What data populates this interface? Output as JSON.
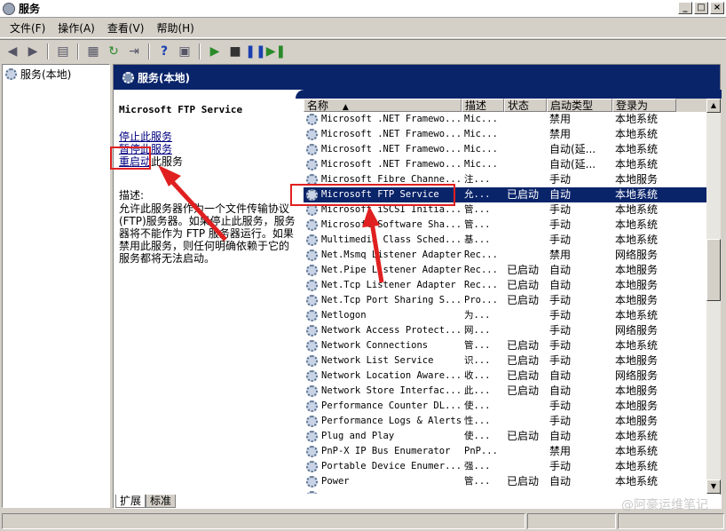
{
  "window": {
    "title": "服务"
  },
  "menu": [
    "文件(F)",
    "操作(A)",
    "查看(V)",
    "帮助(H)"
  ],
  "tree": {
    "root": "服务(本地)"
  },
  "panel": {
    "header": "服务(本地)",
    "selected_service": "Microsoft FTP Service",
    "actions": {
      "stop": "停止此服务",
      "pause": "暂停此服务",
      "restart_link": "重启动",
      "restart_suffix": "此服务"
    },
    "desc_label": "描述:",
    "desc_text": "允许此服务器作为一个文件传输协议(FTP)服务器。如果停止此服务，服务器将不能作为 FTP 服务器运行。如果禁用此服务，则任何明确依赖于它的服务都将无法启动。"
  },
  "columns": {
    "name": "名称",
    "desc": "描述",
    "status": "状态",
    "startup": "启动类型",
    "logon": "登录为"
  },
  "services": [
    {
      "name": "Microsoft .NET Framewo...",
      "desc": "Mic...",
      "status": "",
      "startup": "禁用",
      "logon": "本地系统"
    },
    {
      "name": "Microsoft .NET Framewo...",
      "desc": "Mic...",
      "status": "",
      "startup": "禁用",
      "logon": "本地系统"
    },
    {
      "name": "Microsoft .NET Framewo...",
      "desc": "Mic...",
      "status": "",
      "startup": "自动(延...",
      "logon": "本地系统"
    },
    {
      "name": "Microsoft .NET Framewo...",
      "desc": "Mic...",
      "status": "",
      "startup": "自动(延...",
      "logon": "本地系统"
    },
    {
      "name": "Microsoft Fibre Channe...",
      "desc": "注...",
      "status": "",
      "startup": "手动",
      "logon": "本地服务"
    },
    {
      "name": "Microsoft FTP Service",
      "desc": "允...",
      "status": "已启动",
      "startup": "自动",
      "logon": "本地系统",
      "selected": true
    },
    {
      "name": "Microsoft iSCSI Initia...",
      "desc": "管...",
      "status": "",
      "startup": "手动",
      "logon": "本地系统"
    },
    {
      "name": "Microsoft Software Sha...",
      "desc": "管...",
      "status": "",
      "startup": "手动",
      "logon": "本地系统"
    },
    {
      "name": "Multimedia Class Sched...",
      "desc": "基...",
      "status": "",
      "startup": "手动",
      "logon": "本地系统"
    },
    {
      "name": "Net.Msmq Listener Adapter",
      "desc": "Rec...",
      "status": "",
      "startup": "禁用",
      "logon": "网络服务"
    },
    {
      "name": "Net.Pipe Listener Adapter",
      "desc": "Rec...",
      "status": "已启动",
      "startup": "自动",
      "logon": "本地服务"
    },
    {
      "name": "Net.Tcp Listener Adapter",
      "desc": "Rec...",
      "status": "已启动",
      "startup": "自动",
      "logon": "本地服务"
    },
    {
      "name": "Net.Tcp Port Sharing S...",
      "desc": "Pro...",
      "status": "已启动",
      "startup": "手动",
      "logon": "本地服务"
    },
    {
      "name": "Netlogon",
      "desc": "为...",
      "status": "",
      "startup": "手动",
      "logon": "本地系统"
    },
    {
      "name": "Network Access Protect...",
      "desc": "网...",
      "status": "",
      "startup": "手动",
      "logon": "网络服务"
    },
    {
      "name": "Network Connections",
      "desc": "管...",
      "status": "已启动",
      "startup": "手动",
      "logon": "本地系统"
    },
    {
      "name": "Network List Service",
      "desc": "识...",
      "status": "已启动",
      "startup": "手动",
      "logon": "本地服务"
    },
    {
      "name": "Network Location Aware...",
      "desc": "收...",
      "status": "已启动",
      "startup": "自动",
      "logon": "网络服务"
    },
    {
      "name": "Network Store Interfac...",
      "desc": "此...",
      "status": "已启动",
      "startup": "自动",
      "logon": "本地服务"
    },
    {
      "name": "Performance Counter DL...",
      "desc": "使...",
      "status": "",
      "startup": "手动",
      "logon": "本地服务"
    },
    {
      "name": "Performance Logs & Alerts",
      "desc": "性...",
      "status": "",
      "startup": "手动",
      "logon": "本地服务"
    },
    {
      "name": "Plug and Play",
      "desc": "使...",
      "status": "已启动",
      "startup": "自动",
      "logon": "本地系统"
    },
    {
      "name": "PnP-X IP Bus Enumerator",
      "desc": "PnP...",
      "status": "",
      "startup": "禁用",
      "logon": "本地系统"
    },
    {
      "name": "Portable Device Enumer...",
      "desc": "强...",
      "status": "",
      "startup": "手动",
      "logon": "本地系统"
    },
    {
      "name": "Power",
      "desc": "管...",
      "status": "已启动",
      "startup": "自动",
      "logon": "本地系统"
    },
    {
      "name": "",
      "desc": "",
      "status": "",
      "startup": "",
      "logon": ""
    }
  ],
  "tabs": [
    "扩展",
    "标准"
  ],
  "watermark": "@阿豪运维笔记",
  "colors": {
    "selection": "#0a246a",
    "annotation": "#e02020",
    "link": "#000080"
  }
}
